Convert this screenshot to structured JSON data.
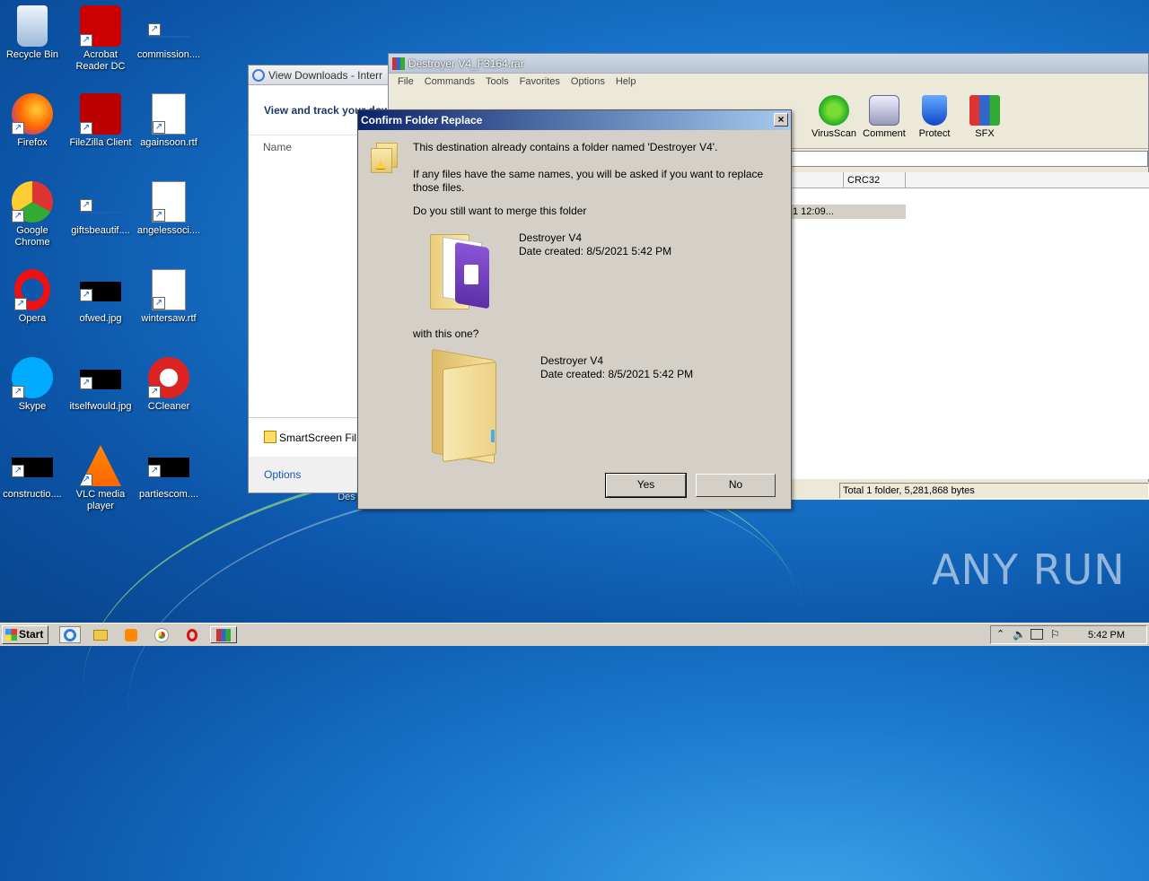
{
  "desktop": {
    "icons": [
      {
        "label": "Recycle Bin",
        "icon": "recycle-bin-icon"
      },
      {
        "label": "Acrobat Reader DC",
        "icon": "acrobat-icon"
      },
      {
        "label": "commission....",
        "icon": "file-icon"
      },
      {
        "label": "Firefox",
        "icon": "firefox-icon"
      },
      {
        "label": "FileZilla Client",
        "icon": "filezilla-icon"
      },
      {
        "label": "againsoon.rtf",
        "icon": "word-doc-icon"
      },
      {
        "label": "Google Chrome",
        "icon": "chrome-icon"
      },
      {
        "label": "giftsbeautif....",
        "icon": "file-icon"
      },
      {
        "label": "angelessoci....",
        "icon": "word-doc-icon"
      },
      {
        "label": "Opera",
        "icon": "opera-icon"
      },
      {
        "label": "ofwed.jpg",
        "icon": "image-icon"
      },
      {
        "label": "wintersaw.rtf",
        "icon": "word-doc-icon"
      },
      {
        "label": "Skype",
        "icon": "skype-icon"
      },
      {
        "label": "itselfwould.jpg",
        "icon": "image-icon"
      },
      {
        "label": "CCleaner",
        "icon": "ccleaner-icon"
      },
      {
        "label": "constructio....",
        "icon": "image-icon"
      },
      {
        "label": "VLC media player",
        "icon": "vlc-icon"
      },
      {
        "label": "partiescom....",
        "icon": "image-icon"
      }
    ],
    "partial_label": "Des",
    "watermark": "ANY RUN"
  },
  "ie_downloads": {
    "title": "View Downloads - Interr",
    "header": "View and track your dow",
    "column_name": "Name",
    "smartscreen": "SmartScreen Fil",
    "options": "Options"
  },
  "winrar": {
    "title": "Destroyer V4_F3164.rar",
    "menu": [
      "File",
      "Commands",
      "Tools",
      "Favorites",
      "Options",
      "Help"
    ],
    "toolbar": [
      "VirusScan",
      "Comment",
      "Protect",
      "SFX"
    ],
    "column_crc": "CRC32",
    "row_modified": "1 12:09...",
    "status": "Total 1 folder, 5,281,868 bytes"
  },
  "dialog": {
    "title": "Confirm Folder Replace",
    "close": "×",
    "line1": "This destination already contains a folder named 'Destroyer V4'.",
    "line2a": "If any files have the same names, you will be asked if you want to replace",
    "line2b": "those files.",
    "line3": "Do you still want to merge this folder",
    "folder1_name": "Destroyer V4",
    "folder1_date": "Date created: 8/5/2021 5:42 PM",
    "with_text": "with this one?",
    "folder2_name": "Destroyer V4",
    "folder2_date": "Date created: 8/5/2021 5:42 PM",
    "yes": "Yes",
    "no": "No"
  },
  "taskbar": {
    "start": "Start",
    "clock": "5:42 PM"
  }
}
